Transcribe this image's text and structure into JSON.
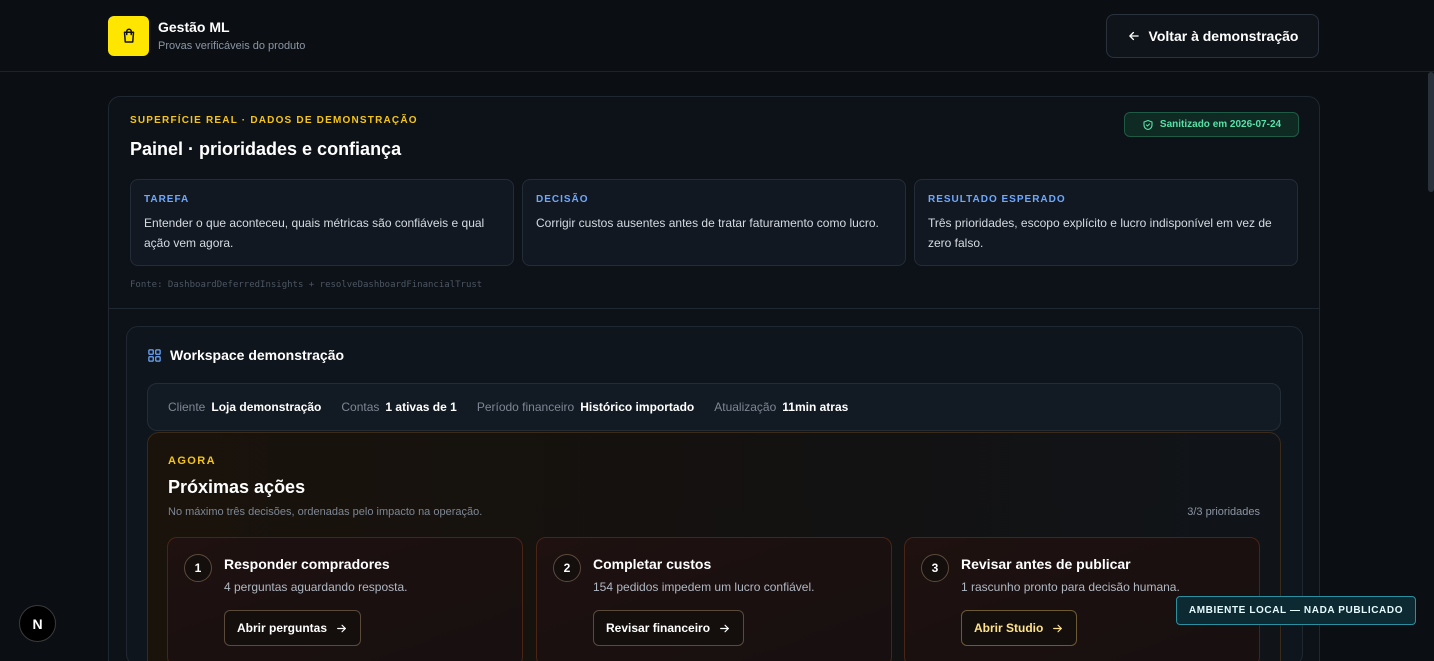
{
  "header": {
    "brand_name": "Gestão ML",
    "brand_subtitle": "Provas verificáveis do produto",
    "back_label": "Voltar à demonstração"
  },
  "panel": {
    "eyebrow": "SUPERFÍCIE REAL · DADOS DE DEMONSTRAÇÃO",
    "title": "Painel · prioridades e confiança",
    "sanitized_badge": "Sanitizado em 2026-07-24",
    "boxes": [
      {
        "label": "TAREFA",
        "text": "Entender o que aconteceu, quais métricas são confiáveis e qual ação vem agora."
      },
      {
        "label": "DECISÃO",
        "text": "Corrigir custos ausentes antes de tratar faturamento como lucro."
      },
      {
        "label": "RESULTADO ESPERADO",
        "text": "Três prioridades, escopo explícito e lucro indisponível em vez de zero falso."
      }
    ],
    "source": "Fonte: DashboardDeferredInsights + resolveDashboardFinancialTrust"
  },
  "workspace": {
    "title": "Workspace demonstração",
    "meta": [
      {
        "key": "Cliente",
        "value": "Loja demonstração"
      },
      {
        "key": "Contas",
        "value": "1 ativas de 1"
      },
      {
        "key": "Período financeiro",
        "value": "Histórico importado"
      },
      {
        "key": "Atualização",
        "value": "11min atras"
      }
    ]
  },
  "agora": {
    "eyebrow": "AGORA",
    "title": "Próximas ações",
    "subtitle": "No máximo três decisões, ordenadas pelo impacto na operação.",
    "count": "3/3 prioridades",
    "actions": [
      {
        "num": "1",
        "title": "Responder compradores",
        "desc": "4 perguntas aguardando resposta.",
        "button": "Abrir perguntas"
      },
      {
        "num": "2",
        "title": "Completar custos",
        "desc": "154 pedidos impedem um lucro confiável.",
        "button": "Revisar financeiro"
      },
      {
        "num": "3",
        "title": "Revisar antes de publicar",
        "desc": "1 rascunho pronto para decisão humana.",
        "button": "Abrir Studio"
      }
    ]
  },
  "overlay": {
    "next_badge": "N",
    "env_badge": "AMBIENTE LOCAL — NADA PUBLICADO"
  },
  "icons": {
    "brand": "shopping-bag-icon",
    "back": "arrow-left-icon",
    "sanitized": "shield-check-icon",
    "workspace": "grid-icon",
    "action": "arrow-right-icon"
  },
  "colors": {
    "brand_yellow": "#ffe600",
    "accent_gold": "#f5c518",
    "label_blue": "#6ea8ff",
    "success_green": "#58e0a8",
    "env_teal": "#2a8fa0"
  }
}
